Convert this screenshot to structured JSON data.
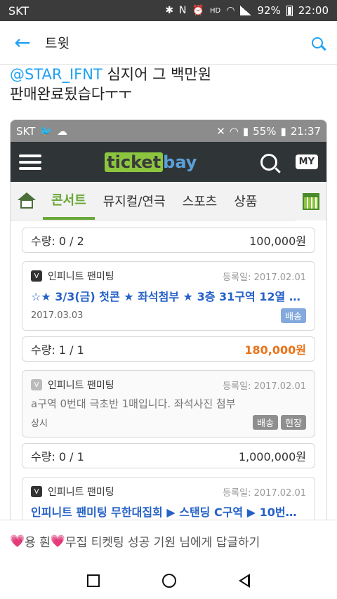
{
  "statusbar": {
    "carrier": "SKT",
    "battery": "92%",
    "time": "22:00",
    "icons": [
      "bluetooth-icon",
      "nfc-icon",
      "alarm-icon",
      "hd-voice-icon",
      "wifi-icon",
      "signal-icon",
      "battery-icon"
    ]
  },
  "appbar": {
    "title": "트윗"
  },
  "tweet": {
    "mention": "@STAR_IFNT",
    "text_line1": " 심지어 그 백만원",
    "text_line2": "판매완료됬습다ㅜㅜ"
  },
  "embedded": {
    "status": {
      "carrier": "SKT",
      "battery": "55%",
      "time": "21:37"
    },
    "header": {
      "logo_left": "ticket",
      "logo_right": "bay",
      "my_label": "MY"
    },
    "tabs": [
      "콘서트",
      "뮤지컬/연극",
      "스포츠",
      "상품"
    ],
    "active_tab": 0,
    "listings": [
      {
        "qty_label": "수량: 0 / 2",
        "price": "100,000원"
      },
      {
        "seller": "인피니트 팬미팅",
        "registered": "등록일: 2017.02.01",
        "title": "☆★ 3/3(금) 첫콘 ★ 좌석첨부 ★ 3층 31구역 12열 1자...",
        "when": "2017.03.03",
        "tags": [
          "배송"
        ],
        "qty_label": "수량: 1 / 1",
        "price": "180,000원"
      },
      {
        "seller": "인피니트 팬미팅",
        "registered": "등록일: 2017.02.01",
        "title": "a구역 0번대 극초반 1매입니다. 좌석사진 첨부",
        "when": "상시",
        "tags": [
          "배송",
          "현장"
        ],
        "qty_label": "수량: 0 / 1",
        "price": "1,000,000원"
      },
      {
        "seller": "인피니트 팬미팅",
        "registered": "등록일: 2017.02.01",
        "title": "인피니트 팬미팅 무한대집회 ▶ 스탠딩 C구역 ▶ 10번대 ..."
      }
    ]
  },
  "reply": {
    "heart_left": "💗",
    "name": "용 훤",
    "heart_right": "💗",
    "suffix": " 무집 티켓팅 성공 기원 님에게 답글하기"
  },
  "colors": {
    "twitter_blue": "#1da1f2",
    "ticketbay_green": "#6aa839",
    "price_orange": "#e8731a",
    "link_blue": "#2561c7"
  }
}
